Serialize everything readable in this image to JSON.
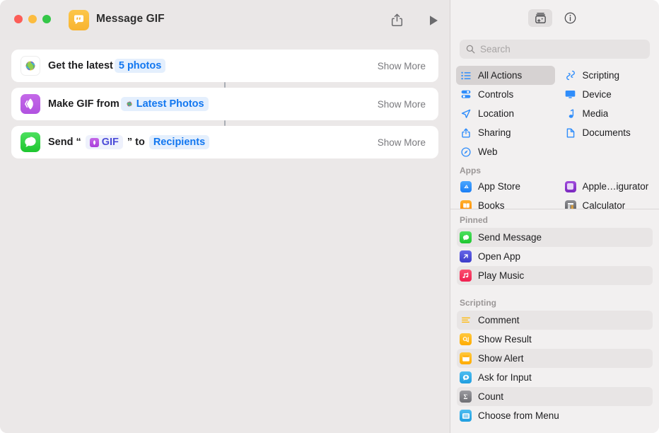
{
  "window": {
    "title": "Message GIF",
    "app_icon": "messages-shortcut-icon",
    "traffic_lights": [
      "close",
      "minimize",
      "zoom"
    ],
    "toolbar": {
      "share_label": "share-icon",
      "run_label": "play-icon"
    }
  },
  "workflow": {
    "actions": [
      {
        "icon": "photos-app-icon",
        "icon_kind": "photos",
        "prefix": "Get the latest",
        "tokens": [
          {
            "label": "5 photos",
            "kind": "plain"
          }
        ],
        "suffix": "",
        "show_more": "Show More"
      },
      {
        "icon": "gif-app-icon",
        "icon_kind": "gif",
        "prefix": "Make GIF from",
        "tokens": [
          {
            "label": "Latest Photos",
            "kind": "photos-token"
          }
        ],
        "suffix": "",
        "show_more": "Show More"
      },
      {
        "icon": "messages-app-icon",
        "icon_kind": "messages",
        "prefix": "Send",
        "quote_open": "“",
        "tokens": [
          {
            "label": "GIF",
            "kind": "gif-token"
          },
          {
            "label": "Recipients",
            "kind": "plain"
          }
        ],
        "quote_close": "”",
        "mid": "to",
        "show_more": "Show More"
      }
    ]
  },
  "sidebar": {
    "toolbar": {
      "library_button": "action-library-icon",
      "info_button": "info-icon"
    },
    "search": {
      "placeholder": "Search",
      "value": ""
    },
    "categories": [
      {
        "label": "All Actions",
        "icon": "list-bullet-icon",
        "selected": true
      },
      {
        "label": "Scripting",
        "icon": "scripting-icon",
        "selected": false
      },
      {
        "label": "Controls",
        "icon": "controls-icon",
        "selected": false
      },
      {
        "label": "Device",
        "icon": "device-icon",
        "selected": false
      },
      {
        "label": "Location",
        "icon": "location-arrow-icon",
        "selected": false
      },
      {
        "label": "Media",
        "icon": "music-note-icon",
        "selected": false
      },
      {
        "label": "Sharing",
        "icon": "share-icon",
        "selected": false
      },
      {
        "label": "Documents",
        "icon": "document-icon",
        "selected": false
      },
      {
        "label": "Web",
        "icon": "safari-compass-icon",
        "selected": false
      }
    ],
    "apps_header": "Apps",
    "apps": [
      {
        "label": "App Store",
        "icon": "app-store-icon",
        "color": "#2f8dfb"
      },
      {
        "label": "Apple…igurator",
        "icon": "apple-configurator-icon",
        "color": "#8b3fd4"
      },
      {
        "label": "Books",
        "icon": "books-icon",
        "color": "#ff9a1f"
      },
      {
        "label": "Calculator",
        "icon": "calculator-icon",
        "color": "#6d6d70"
      }
    ],
    "pinned_header": "Pinned",
    "pinned": [
      {
        "label": "Send Message",
        "icon": "messages-icon",
        "color": "#2fd63f"
      },
      {
        "label": "Open App",
        "icon": "open-app-icon",
        "color": "#4b4bd8"
      },
      {
        "label": "Play Music",
        "icon": "music-icon",
        "color": "#f8385c"
      }
    ],
    "scripting_header": "Scripting",
    "scripting": [
      {
        "label": "Comment",
        "icon": "comment-icon",
        "color": "#ffb90a"
      },
      {
        "label": "Show Result",
        "icon": "show-result-icon",
        "color": "#ffb90a"
      },
      {
        "label": "Show Alert",
        "icon": "show-alert-icon",
        "color": "#ffc01c"
      },
      {
        "label": "Ask for Input",
        "icon": "ask-for-input-icon",
        "color": "#32ade6"
      },
      {
        "label": "Count",
        "icon": "count-icon",
        "color": "#8e8e93"
      },
      {
        "label": "Choose from Menu",
        "icon": "choose-from-menu-icon",
        "color": "#32ade6"
      }
    ]
  },
  "colors": {
    "accent_blue": "#1277f0",
    "token_bg": "#e4effd",
    "canvas": "#ebe8e8",
    "panel": "#f2f0f0"
  }
}
